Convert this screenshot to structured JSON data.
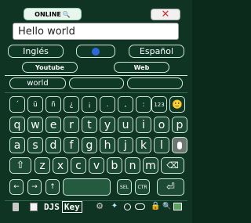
{
  "top": {
    "online_label": "ONLINE",
    "close_glyph": "✕"
  },
  "input": {
    "value": "Hello world"
  },
  "languages": {
    "from": "Inglés",
    "swap_icon": "globe-icon",
    "to": "Español"
  },
  "links": {
    "youtube": "Youtube",
    "web": "Web"
  },
  "suggestions": [
    "world",
    "",
    ""
  ],
  "keys": {
    "row0": [
      "´",
      "ü",
      "ñ",
      "¿",
      "¡",
      ".",
      ",",
      ":",
      "123",
      "🙂"
    ],
    "row1": [
      "q",
      "w",
      "e",
      "r",
      "t",
      "y",
      "u",
      "i",
      "o",
      "p"
    ],
    "row2": [
      "a",
      "s",
      "d",
      "f",
      "g",
      "h",
      "j",
      "k",
      "l"
    ],
    "row3": [
      "z",
      "x",
      "c",
      "v",
      "b",
      "n",
      "m"
    ],
    "sel": "SEL",
    "ctr": "CTR"
  },
  "bottom": {
    "logo_djs": "DJS",
    "logo_key": "Key"
  },
  "colors": {
    "background": "#0f3424",
    "key_fill": "#1c4a35",
    "accent_red": "#d62828",
    "globe_blue": "#2d6ad8"
  }
}
